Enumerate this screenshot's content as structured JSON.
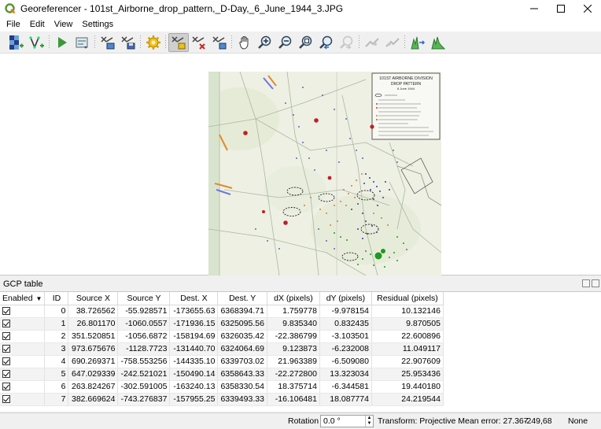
{
  "window": {
    "title": "Georeferencer - 101st_Airborne_drop_pattern,_D-Day,_6_June_1944_3.JPG"
  },
  "menu": {
    "items": [
      "File",
      "Edit",
      "View",
      "Settings"
    ]
  },
  "map_image": {
    "title_line1": "101ST AIRBORNE DIVISION",
    "title_line2": "DROP PATTERN",
    "title_line3": "6 June 1944"
  },
  "gcp": {
    "panel_title": "GCP table",
    "columns": [
      "Enabled",
      "ID",
      "Source X",
      "Source Y",
      "Dest. X",
      "Dest. Y",
      "dX (pixels)",
      "dY (pixels)",
      "Residual (pixels)"
    ],
    "rows": [
      {
        "id": "0",
        "sx": "38.726562",
        "sy": "-55.928571",
        "dx": "-173655.63",
        "dy": "6368394.71",
        "dxp": "1.759778",
        "dyp": "-9.978154",
        "res": "10.132146"
      },
      {
        "id": "1",
        "sx": "26.801170",
        "sy": "-1060.0557",
        "dx": "-171936.15",
        "dy": "6325095.56",
        "dxp": "9.835340",
        "dyp": "0.832435",
        "res": "9.870505"
      },
      {
        "id": "2",
        "sx": "351.520851",
        "sy": "-1056.6872",
        "dx": "-158194.69",
        "dy": "6326035.42",
        "dxp": "-22.386799",
        "dyp": "-3.103501",
        "res": "22.600896"
      },
      {
        "id": "3",
        "sx": "973.675676",
        "sy": "-1128.7723",
        "dx": "-131440.70",
        "dy": "6324064.69",
        "dxp": "9.123873",
        "dyp": "-6.232008",
        "res": "11.049117"
      },
      {
        "id": "4",
        "sx": "690.269371",
        "sy": "-758.553256",
        "dx": "-144335.10",
        "dy": "6339703.02",
        "dxp": "21.963389",
        "dyp": "-6.509080",
        "res": "22.907609"
      },
      {
        "id": "5",
        "sx": "647.029339",
        "sy": "-242.521021",
        "dx": "-150490.14",
        "dy": "6358643.33",
        "dxp": "-22.272800",
        "dyp": "13.323034",
        "res": "25.953436"
      },
      {
        "id": "6",
        "sx": "263.824267",
        "sy": "-302.591005",
        "dx": "-163240.13",
        "dy": "6358330.54",
        "dxp": "18.375714",
        "dyp": "-6.344581",
        "res": "19.440180"
      },
      {
        "id": "7",
        "sx": "382.669624",
        "sy": "-743.276837",
        "dx": "-157955.25",
        "dy": "6339493.33",
        "dxp": "-16.106481",
        "dyp": "18.087774",
        "res": "24.219544"
      }
    ]
  },
  "status": {
    "rotation_label": "Rotation",
    "rotation_value": "0.0 °",
    "transform_text": "Transform: Projective Mean error: 27.367",
    "coords": "-249,68",
    "crs": "None"
  },
  "colors": {
    "accent_green": "#3a9a3a",
    "toolbar_bg": "#f0f0f0"
  }
}
